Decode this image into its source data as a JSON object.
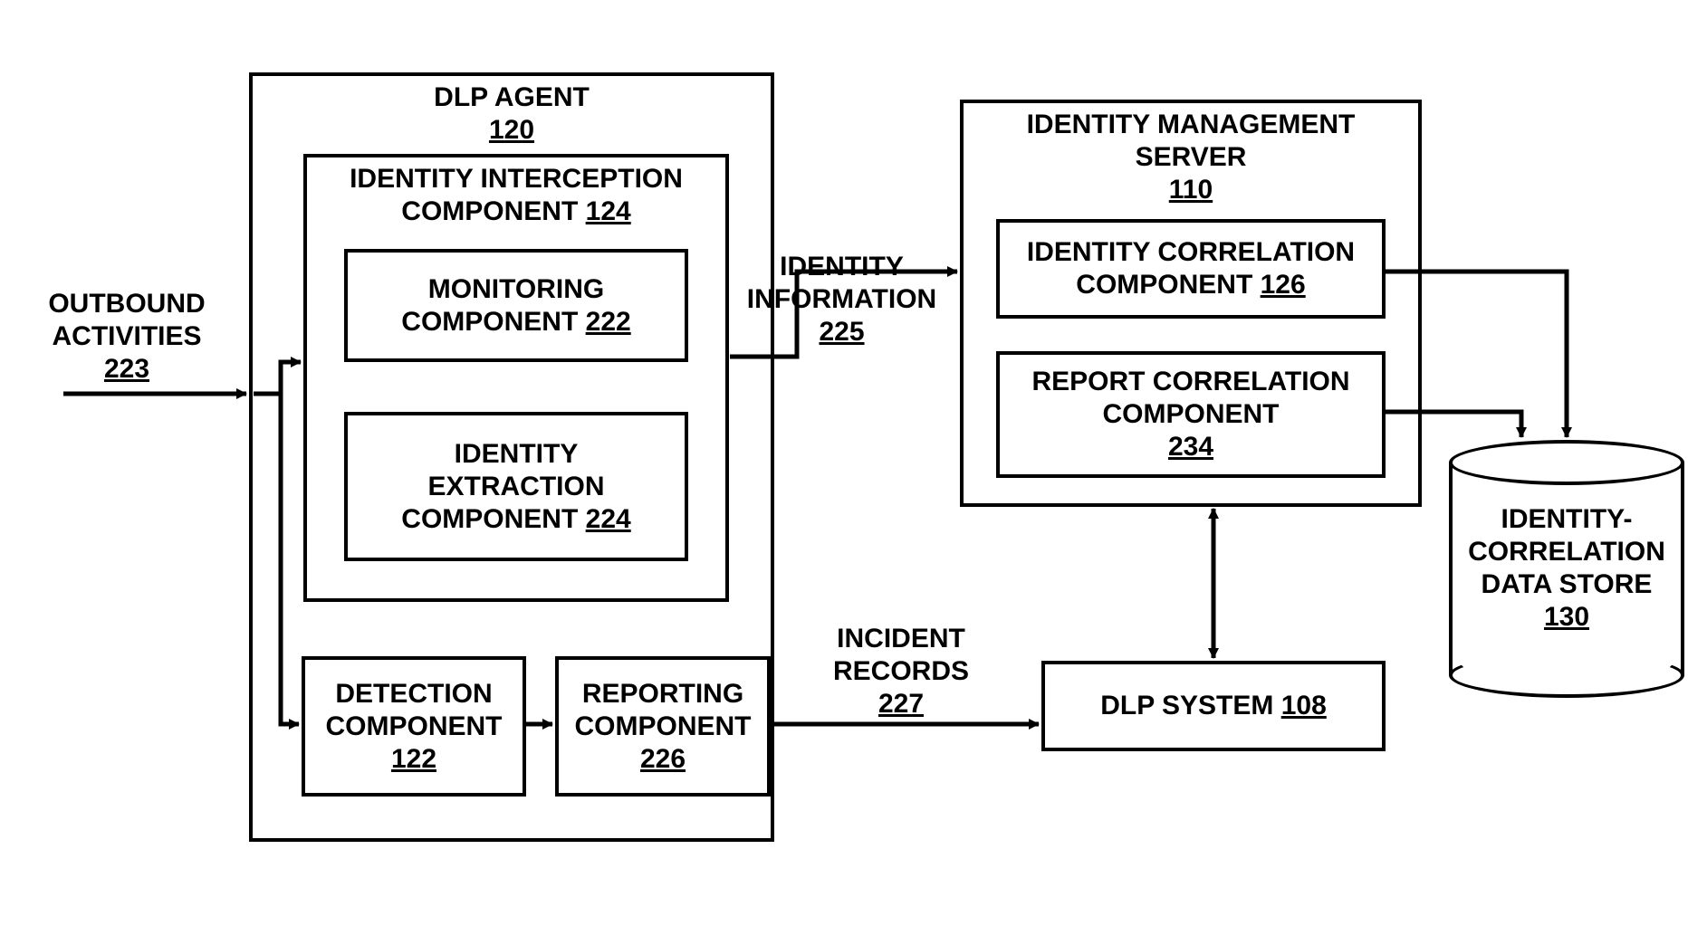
{
  "outbound": {
    "label": "OUTBOUND\nACTIVITIES",
    "num": "223"
  },
  "dlpAgent": {
    "title": "DLP AGENT",
    "num": "120"
  },
  "intercept": {
    "title": "IDENTITY INTERCEPTION\nCOMPONENT",
    "num": "124"
  },
  "monitoring": {
    "title": "MONITORING\nCOMPONENT",
    "num": "222"
  },
  "extraction": {
    "title": "IDENTITY\nEXTRACTION\nCOMPONENT",
    "num": "224"
  },
  "detection": {
    "title": "DETECTION\nCOMPONENT",
    "num": "122"
  },
  "reporting": {
    "title": "REPORTING\nCOMPONENT",
    "num": "226"
  },
  "identityInfo": {
    "label": "IDENTITY\nINFORMATION",
    "num": "225"
  },
  "incidentRecords": {
    "label": "INCIDENT\nRECORDS",
    "num": "227"
  },
  "idmServer": {
    "title": "IDENTITY MANAGEMENT\nSERVER",
    "num": "110"
  },
  "idCorrelation": {
    "title": "IDENTITY CORRELATION\nCOMPONENT",
    "num": "126"
  },
  "reportCorrelation": {
    "title": "REPORT CORRELATION\nCOMPONENT",
    "num": "234"
  },
  "dlpSystem": {
    "title": "DLP SYSTEM",
    "num": "108"
  },
  "dataStore": {
    "title": "IDENTITY-\nCORRELATION\nDATA STORE",
    "num": "130"
  }
}
